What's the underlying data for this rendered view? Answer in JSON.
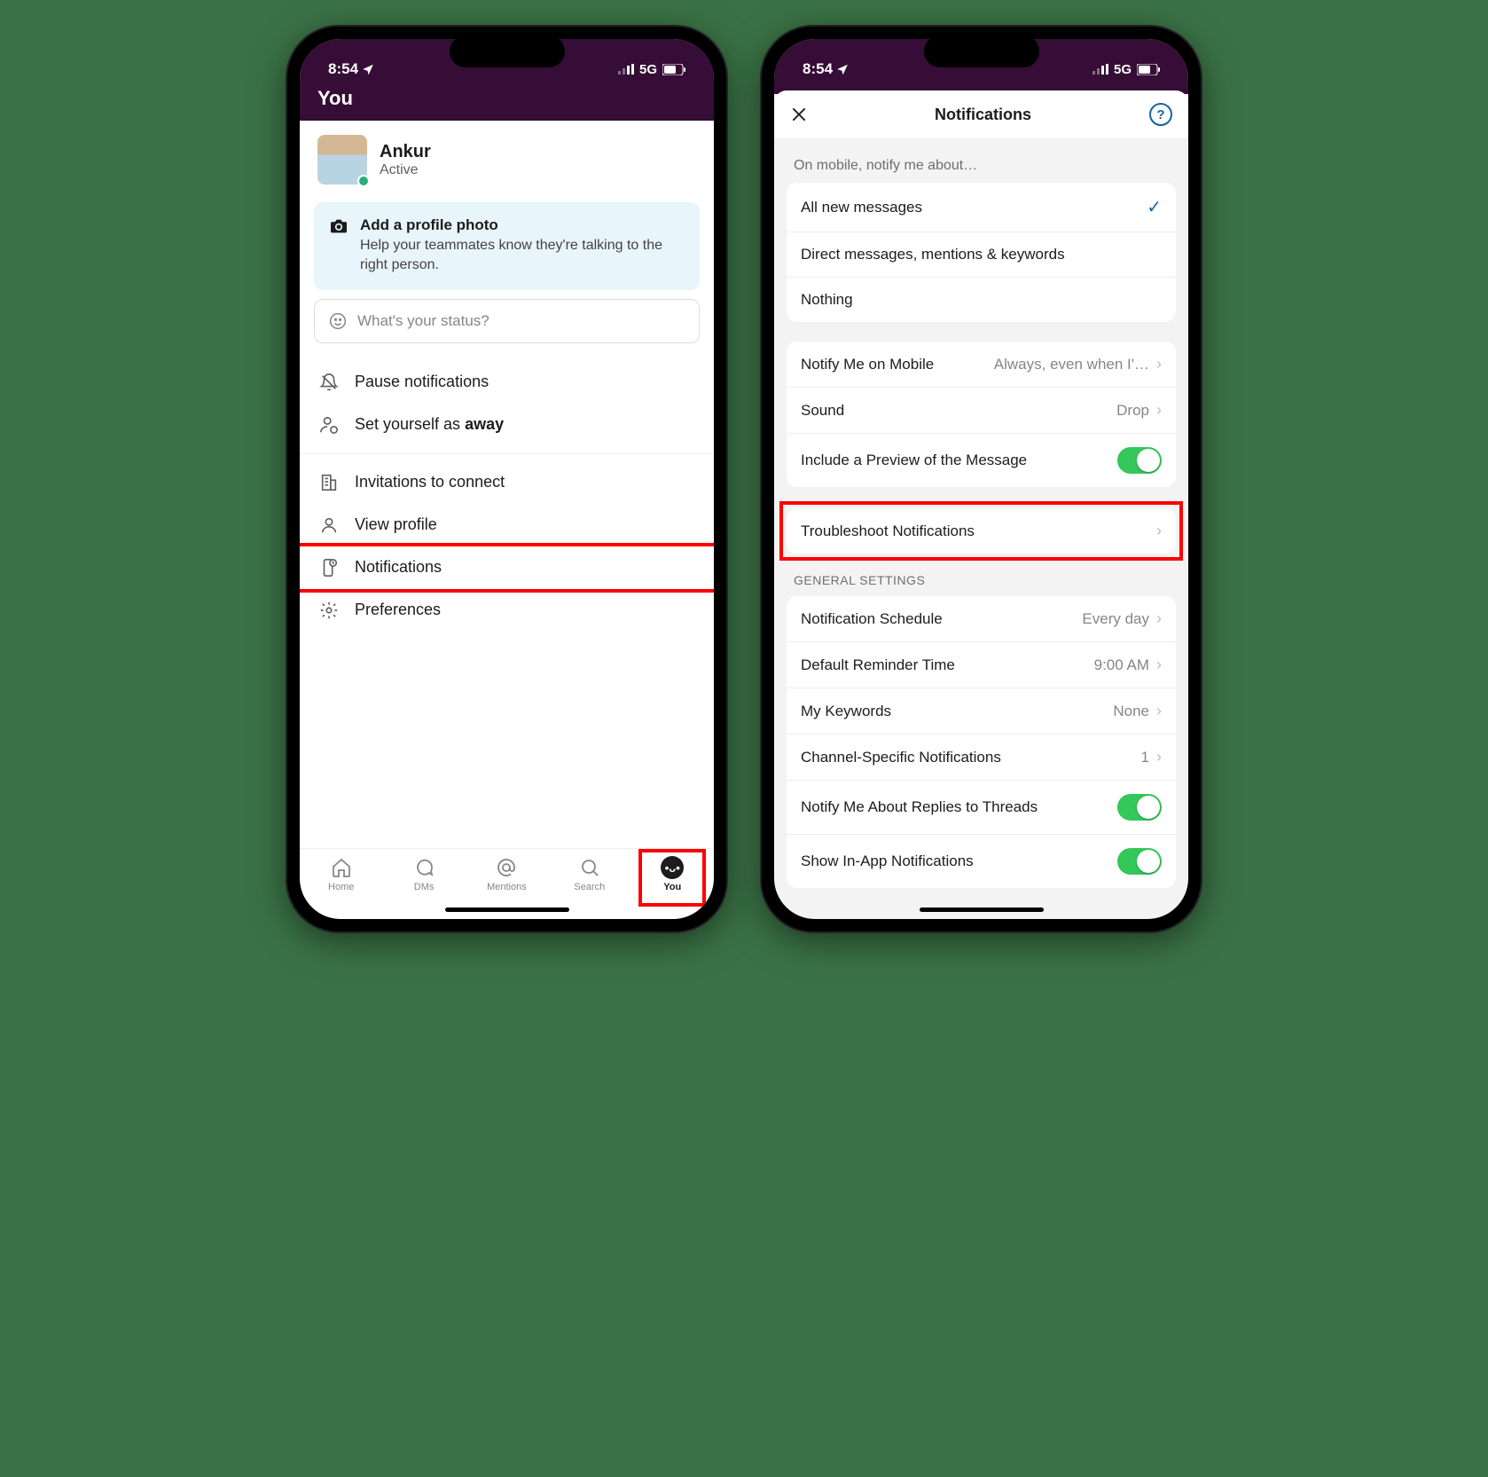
{
  "statusbar": {
    "time": "8:54",
    "network": "5G"
  },
  "phone1": {
    "header": "You",
    "profile": {
      "name": "Ankur",
      "status": "Active"
    },
    "banner": {
      "title": "Add a profile photo",
      "subtitle": "Help your teammates know they're talking to the right person."
    },
    "status_placeholder": "What's your status?",
    "menu": {
      "pause": "Pause notifications",
      "away_prefix": "Set yourself as ",
      "away_bold": "away",
      "invites": "Invitations to connect",
      "view_profile": "View profile",
      "notifications": "Notifications",
      "preferences": "Preferences"
    },
    "tabs": {
      "home": "Home",
      "dms": "DMs",
      "mentions": "Mentions",
      "search": "Search",
      "you": "You"
    }
  },
  "phone2": {
    "title": "Notifications",
    "sections": {
      "notify_about_label": "On mobile, notify me about…",
      "notify_about": {
        "all": "All new messages",
        "dms": "Direct messages, mentions & keywords",
        "nothing": "Nothing"
      },
      "mobile": {
        "notify_on_mobile": {
          "label": "Notify Me on Mobile",
          "value": "Always, even when I'…"
        },
        "sound": {
          "label": "Sound",
          "value": "Drop"
        },
        "preview": "Include a Preview of the Message"
      },
      "troubleshoot": "Troubleshoot Notifications",
      "general_label": "GENERAL SETTINGS",
      "general": {
        "schedule": {
          "label": "Notification Schedule",
          "value": "Every day"
        },
        "reminder": {
          "label": "Default Reminder Time",
          "value": "9:00 AM"
        },
        "keywords": {
          "label": "My Keywords",
          "value": "None"
        },
        "channel": {
          "label": "Channel-Specific Notifications",
          "value": "1"
        },
        "threads": "Notify Me About Replies to Threads",
        "inapp": "Show In-App Notifications"
      }
    }
  }
}
